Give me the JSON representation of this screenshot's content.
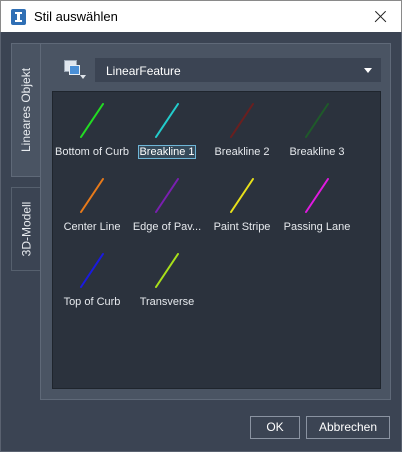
{
  "window": {
    "title": "Stil auswählen"
  },
  "tabs": [
    {
      "label": "Lineares Objekt",
      "active": true
    },
    {
      "label": "3D-Modell",
      "active": false
    }
  ],
  "style_selector": {
    "value": "LinearFeature"
  },
  "gallery": {
    "items": [
      {
        "label": "Bottom of Curb",
        "color": "#22dd22",
        "selected": false
      },
      {
        "label": "Breakline 1",
        "color": "#22cccc",
        "selected": true
      },
      {
        "label": "Breakline 2",
        "color": "#6a1f1f",
        "selected": false
      },
      {
        "label": "Breakline 3",
        "color": "#1f5a2a",
        "selected": false
      },
      {
        "label": "Center Line",
        "color": "#e87a1a",
        "selected": false
      },
      {
        "label": "Edge of Pav...",
        "color": "#7a1fb0",
        "selected": false
      },
      {
        "label": "Paint Stripe",
        "color": "#e8e01a",
        "selected": false
      },
      {
        "label": "Passing Lane",
        "color": "#e01ae0",
        "selected": false
      },
      {
        "label": "Top of Curb",
        "color": "#1a1ae0",
        "selected": false
      },
      {
        "label": "Transverse",
        "color": "#a8e01a",
        "selected": false
      }
    ]
  },
  "footer": {
    "ok_label": "OK",
    "cancel_label": "Abbrechen"
  }
}
